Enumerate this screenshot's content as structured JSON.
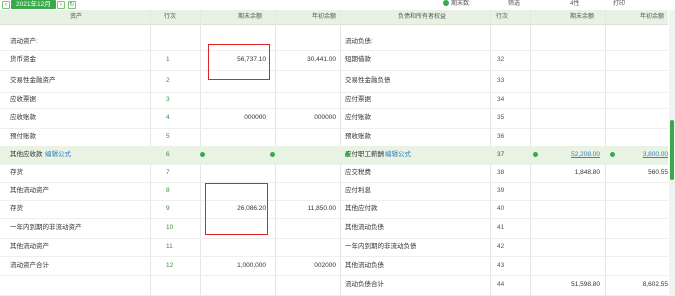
{
  "toolbar": {
    "prev": "‹",
    "period": "2021年12月",
    "next": "›",
    "refresh": "↻",
    "check_label": "期末数:",
    "ctrl_a": "筛选",
    "ctrl_b": "4性",
    "ctrl_c": "打印",
    "colors": {
      "accent": "#39a94a",
      "header": "#e8f2e4",
      "highlight": "#e8f3e4",
      "box": "#e02424"
    }
  },
  "header": {
    "asset": "资产",
    "line": "行次",
    "end": "期末余额",
    "start": "年初余额",
    "liab": "负债和所有者权益",
    "line2": "行次",
    "end2": "期末余额",
    "start2": "年初余额"
  },
  "rows": [
    {
      "left": "流动资产:",
      "ln": "",
      "end": "",
      "start": "",
      "right": "流动负债:",
      "ln2": ""
    },
    {
      "left": "货币资金",
      "ln": "1",
      "end": "56,737.10",
      "start": "30,441.00",
      "right": "短期借款",
      "ln2": "32"
    },
    {
      "left": "交易性金融资产",
      "ln": "2",
      "end": "",
      "start": "",
      "right": "交易性金融负债",
      "ln2": "33"
    },
    {
      "left": "应收票据",
      "ln": "3",
      "end": "",
      "start": "",
      "right": "应付票据",
      "ln2": "34"
    },
    {
      "left": "应收账款",
      "ln": "4",
      "end": "000000",
      "start": "000000",
      "right": "应付账款",
      "ln2": "35"
    },
    {
      "left": "预付账款",
      "ln": "5",
      "end": "",
      "start": "",
      "right": "预收账款",
      "ln2": "36"
    },
    {
      "left": "其他应收款",
      "ln": "6",
      "end": "",
      "start": "",
      "right": "应付职工薪酬",
      "ln2": "37",
      "end2": "52,208.00",
      "start2": "3,800.00"
    },
    {
      "left": "存货",
      "ln": "7",
      "end": "",
      "start": "",
      "right": "应交税费",
      "ln2": "38",
      "end2": "1,848.80",
      "start2": "560.55"
    },
    {
      "left": "其他流动资产",
      "ln": "8",
      "end": "",
      "start": "",
      "right": "应付利息",
      "ln2": "39"
    },
    {
      "left": "存货",
      "ln": "9",
      "end": "26,086.20",
      "start": "11,850.00",
      "right": "其他应付款",
      "ln2": "40"
    },
    {
      "left": "一年内到期的非流动资产",
      "ln": "10",
      "end": "",
      "start": "",
      "right": "其他流动负债",
      "ln2": "41"
    },
    {
      "left": "其他流动资产",
      "ln": "11",
      "end": "",
      "start": "",
      "right": "一年内到期的非流动负债",
      "ln2": "42"
    },
    {
      "left": "流动资产合计",
      "ln": "12",
      "end": "1,000,000",
      "start": "002000",
      "right": "其他流动负债",
      "ln2": "43"
    },
    {
      "left": "",
      "ln": "",
      "end": "",
      "start": "",
      "right": "流动负债合计",
      "ln2": "44",
      "end2": "51,598.80",
      "start2": "8,602.55"
    }
  ],
  "link": "编辑公式"
}
